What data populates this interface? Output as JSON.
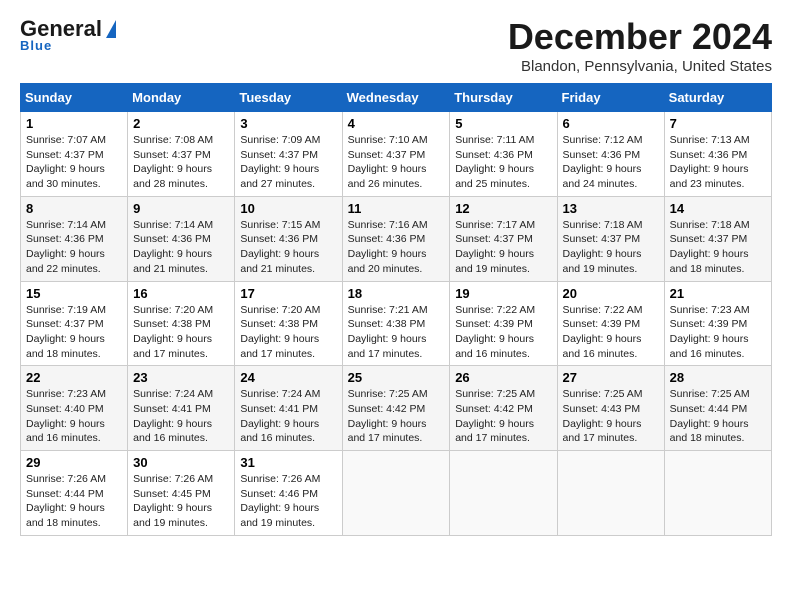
{
  "header": {
    "logo_general": "General",
    "logo_blue": "Blue",
    "month": "December 2024",
    "location": "Blandon, Pennsylvania, United States"
  },
  "days_of_week": [
    "Sunday",
    "Monday",
    "Tuesday",
    "Wednesday",
    "Thursday",
    "Friday",
    "Saturday"
  ],
  "weeks": [
    [
      {
        "day": "1",
        "info": "Sunrise: 7:07 AM\nSunset: 4:37 PM\nDaylight: 9 hours and 30 minutes."
      },
      {
        "day": "2",
        "info": "Sunrise: 7:08 AM\nSunset: 4:37 PM\nDaylight: 9 hours and 28 minutes."
      },
      {
        "day": "3",
        "info": "Sunrise: 7:09 AM\nSunset: 4:37 PM\nDaylight: 9 hours and 27 minutes."
      },
      {
        "day": "4",
        "info": "Sunrise: 7:10 AM\nSunset: 4:37 PM\nDaylight: 9 hours and 26 minutes."
      },
      {
        "day": "5",
        "info": "Sunrise: 7:11 AM\nSunset: 4:36 PM\nDaylight: 9 hours and 25 minutes."
      },
      {
        "day": "6",
        "info": "Sunrise: 7:12 AM\nSunset: 4:36 PM\nDaylight: 9 hours and 24 minutes."
      },
      {
        "day": "7",
        "info": "Sunrise: 7:13 AM\nSunset: 4:36 PM\nDaylight: 9 hours and 23 minutes."
      }
    ],
    [
      {
        "day": "8",
        "info": "Sunrise: 7:14 AM\nSunset: 4:36 PM\nDaylight: 9 hours and 22 minutes."
      },
      {
        "day": "9",
        "info": "Sunrise: 7:14 AM\nSunset: 4:36 PM\nDaylight: 9 hours and 21 minutes."
      },
      {
        "day": "10",
        "info": "Sunrise: 7:15 AM\nSunset: 4:36 PM\nDaylight: 9 hours and 21 minutes."
      },
      {
        "day": "11",
        "info": "Sunrise: 7:16 AM\nSunset: 4:36 PM\nDaylight: 9 hours and 20 minutes."
      },
      {
        "day": "12",
        "info": "Sunrise: 7:17 AM\nSunset: 4:37 PM\nDaylight: 9 hours and 19 minutes."
      },
      {
        "day": "13",
        "info": "Sunrise: 7:18 AM\nSunset: 4:37 PM\nDaylight: 9 hours and 19 minutes."
      },
      {
        "day": "14",
        "info": "Sunrise: 7:18 AM\nSunset: 4:37 PM\nDaylight: 9 hours and 18 minutes."
      }
    ],
    [
      {
        "day": "15",
        "info": "Sunrise: 7:19 AM\nSunset: 4:37 PM\nDaylight: 9 hours and 18 minutes."
      },
      {
        "day": "16",
        "info": "Sunrise: 7:20 AM\nSunset: 4:38 PM\nDaylight: 9 hours and 17 minutes."
      },
      {
        "day": "17",
        "info": "Sunrise: 7:20 AM\nSunset: 4:38 PM\nDaylight: 9 hours and 17 minutes."
      },
      {
        "day": "18",
        "info": "Sunrise: 7:21 AM\nSunset: 4:38 PM\nDaylight: 9 hours and 17 minutes."
      },
      {
        "day": "19",
        "info": "Sunrise: 7:22 AM\nSunset: 4:39 PM\nDaylight: 9 hours and 16 minutes."
      },
      {
        "day": "20",
        "info": "Sunrise: 7:22 AM\nSunset: 4:39 PM\nDaylight: 9 hours and 16 minutes."
      },
      {
        "day": "21",
        "info": "Sunrise: 7:23 AM\nSunset: 4:39 PM\nDaylight: 9 hours and 16 minutes."
      }
    ],
    [
      {
        "day": "22",
        "info": "Sunrise: 7:23 AM\nSunset: 4:40 PM\nDaylight: 9 hours and 16 minutes."
      },
      {
        "day": "23",
        "info": "Sunrise: 7:24 AM\nSunset: 4:41 PM\nDaylight: 9 hours and 16 minutes."
      },
      {
        "day": "24",
        "info": "Sunrise: 7:24 AM\nSunset: 4:41 PM\nDaylight: 9 hours and 16 minutes."
      },
      {
        "day": "25",
        "info": "Sunrise: 7:25 AM\nSunset: 4:42 PM\nDaylight: 9 hours and 17 minutes."
      },
      {
        "day": "26",
        "info": "Sunrise: 7:25 AM\nSunset: 4:42 PM\nDaylight: 9 hours and 17 minutes."
      },
      {
        "day": "27",
        "info": "Sunrise: 7:25 AM\nSunset: 4:43 PM\nDaylight: 9 hours and 17 minutes."
      },
      {
        "day": "28",
        "info": "Sunrise: 7:25 AM\nSunset: 4:44 PM\nDaylight: 9 hours and 18 minutes."
      }
    ],
    [
      {
        "day": "29",
        "info": "Sunrise: 7:26 AM\nSunset: 4:44 PM\nDaylight: 9 hours and 18 minutes."
      },
      {
        "day": "30",
        "info": "Sunrise: 7:26 AM\nSunset: 4:45 PM\nDaylight: 9 hours and 19 minutes."
      },
      {
        "day": "31",
        "info": "Sunrise: 7:26 AM\nSunset: 4:46 PM\nDaylight: 9 hours and 19 minutes."
      },
      null,
      null,
      null,
      null
    ]
  ]
}
